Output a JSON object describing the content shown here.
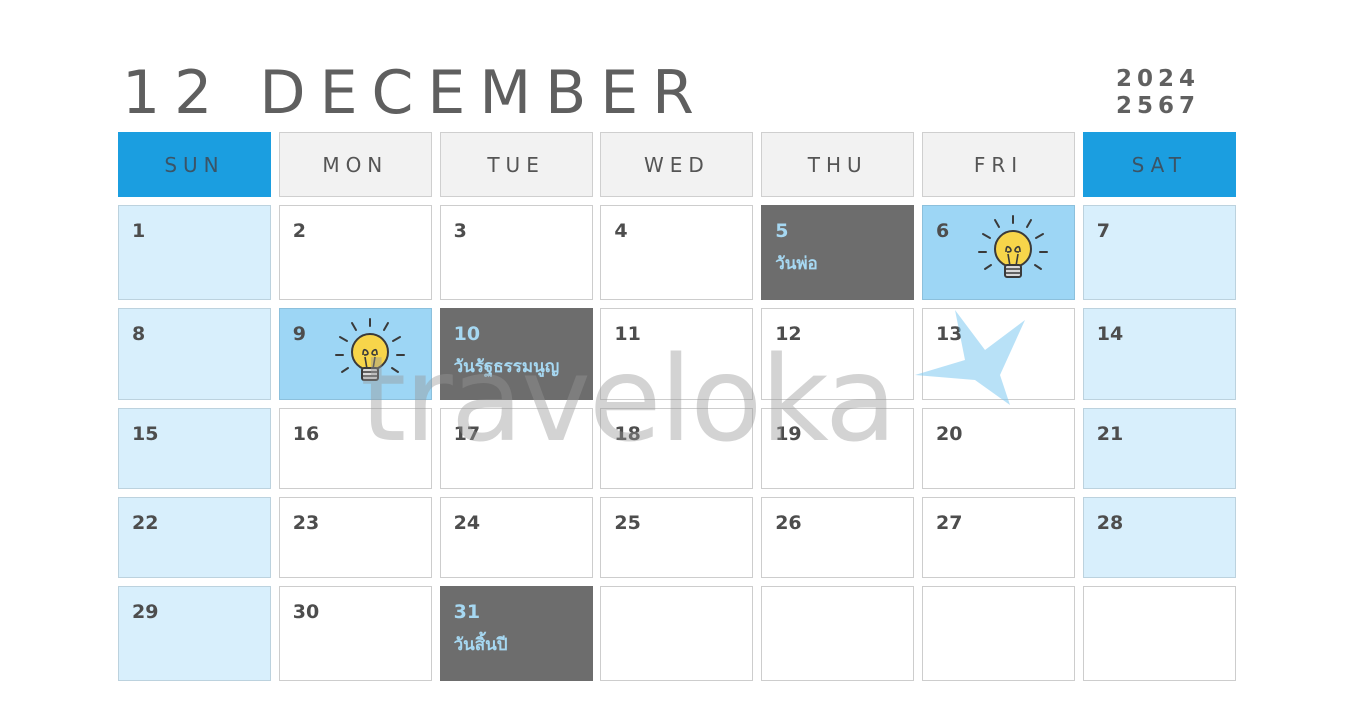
{
  "header": {
    "title": "12 DECEMBER",
    "year_ad": "2024",
    "year_be": "2567"
  },
  "weekdays": [
    {
      "label": "SUN",
      "weekend": true
    },
    {
      "label": "MON",
      "weekend": false
    },
    {
      "label": "TUE",
      "weekend": false
    },
    {
      "label": "WED",
      "weekend": false
    },
    {
      "label": "THU",
      "weekend": false
    },
    {
      "label": "FRI",
      "weekend": false
    },
    {
      "label": "SAT",
      "weekend": true
    }
  ],
  "weeks": [
    [
      {
        "day": "1",
        "type": "weekend"
      },
      {
        "day": "2",
        "type": "normal"
      },
      {
        "day": "3",
        "type": "normal"
      },
      {
        "day": "4",
        "type": "normal"
      },
      {
        "day": "5",
        "type": "holiday",
        "holiday": "วันพ่อ"
      },
      {
        "day": "6",
        "type": "idea",
        "icon": "lightbulb-icon"
      },
      {
        "day": "7",
        "type": "weekend"
      }
    ],
    [
      {
        "day": "8",
        "type": "weekend"
      },
      {
        "day": "9",
        "type": "idea",
        "icon": "lightbulb-icon"
      },
      {
        "day": "10",
        "type": "holiday",
        "holiday": "วันรัฐธรรมนูญ"
      },
      {
        "day": "11",
        "type": "normal"
      },
      {
        "day": "12",
        "type": "normal"
      },
      {
        "day": "13",
        "type": "normal"
      },
      {
        "day": "14",
        "type": "weekend"
      }
    ],
    [
      {
        "day": "15",
        "type": "weekend"
      },
      {
        "day": "16",
        "type": "normal"
      },
      {
        "day": "17",
        "type": "normal"
      },
      {
        "day": "18",
        "type": "normal"
      },
      {
        "day": "19",
        "type": "normal"
      },
      {
        "day": "20",
        "type": "normal"
      },
      {
        "day": "21",
        "type": "weekend"
      }
    ],
    [
      {
        "day": "22",
        "type": "weekend"
      },
      {
        "day": "23",
        "type": "normal"
      },
      {
        "day": "24",
        "type": "normal"
      },
      {
        "day": "25",
        "type": "normal"
      },
      {
        "day": "26",
        "type": "normal"
      },
      {
        "day": "27",
        "type": "normal"
      },
      {
        "day": "28",
        "type": "weekend"
      }
    ],
    [
      {
        "day": "29",
        "type": "weekend"
      },
      {
        "day": "30",
        "type": "normal"
      },
      {
        "day": "31",
        "type": "holiday",
        "holiday": "วันสิ้นปี"
      },
      {
        "day": "",
        "type": "empty"
      },
      {
        "day": "",
        "type": "empty"
      },
      {
        "day": "",
        "type": "empty"
      },
      {
        "day": "",
        "type": "empty"
      }
    ]
  ],
  "watermark": {
    "text": "traveloka",
    "icon": "traveloka-bird-icon"
  },
  "colors": {
    "weekend_header": "#1b9ee0",
    "weekend_cell": "#d8effc",
    "holiday_cell": "#6d6d6d",
    "holiday_text": "#a6d8f2",
    "idea_cell": "#9dd6f5"
  }
}
